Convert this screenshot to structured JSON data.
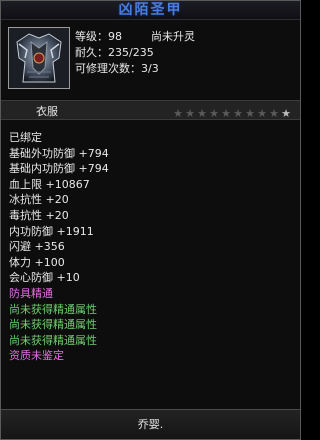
{
  "title": "凶陌圣甲",
  "colors": {
    "title": "#4a7de0",
    "white": "#e8e8e8",
    "pink": "#e070e0",
    "green": "#6fcf6f",
    "star_empty": "#5a5a5a",
    "star_last": "#bcbcbc"
  },
  "item": {
    "icon": "armor-icon",
    "level": "等级：98",
    "spirit_status": "尚未升灵",
    "durability": "耐久：235/235",
    "repair": "可修理次数：3/3",
    "type": "衣服",
    "stars_total": 10,
    "stars_filled": 0
  },
  "stats": [
    {
      "text": "已绑定",
      "color": "white"
    },
    {
      "text": "基础外功防御 +794",
      "color": "white"
    },
    {
      "text": "基础内功防御 +794",
      "color": "white"
    },
    {
      "text": "血上限 +10867",
      "color": "white"
    },
    {
      "text": "冰抗性 +20",
      "color": "white"
    },
    {
      "text": "毒抗性 +20",
      "color": "white"
    },
    {
      "text": "内功防御 +1911",
      "color": "white"
    },
    {
      "text": "闪避 +356",
      "color": "white"
    },
    {
      "text": "体力 +100",
      "color": "white"
    },
    {
      "text": "会心防御 +10",
      "color": "white"
    },
    {
      "text": "防具精通",
      "color": "pink"
    },
    {
      "text": "尚未获得精通属性",
      "color": "green"
    },
    {
      "text": "尚未获得精通属性",
      "color": "green"
    },
    {
      "text": "尚未获得精通属性",
      "color": "green"
    },
    {
      "text": "资质未鉴定",
      "color": "pink"
    }
  ],
  "footer": {
    "signature": "乔婴."
  }
}
